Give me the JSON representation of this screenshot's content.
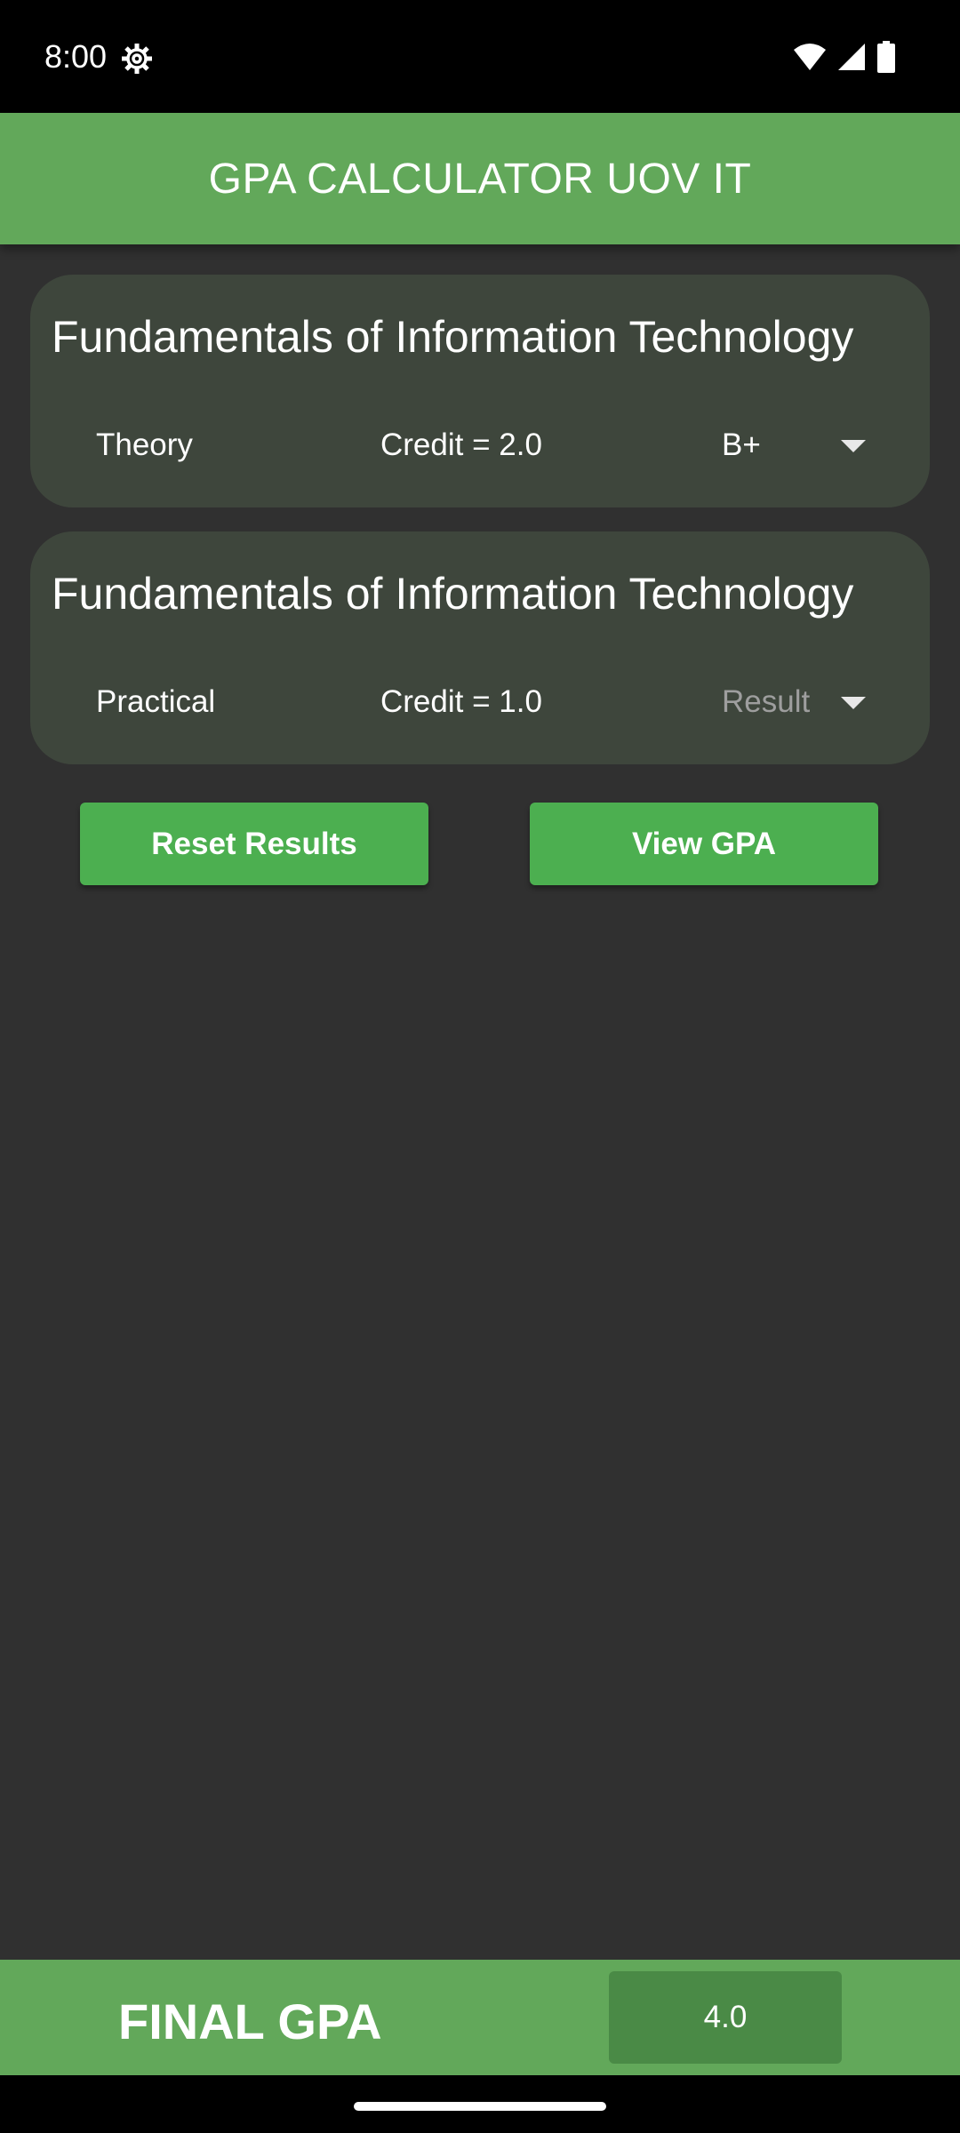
{
  "status_bar": {
    "time": "8:00",
    "icons": [
      "settings-gear-icon",
      "wifi-icon",
      "signal-icon",
      "battery-icon"
    ]
  },
  "app_bar": {
    "title": "GPA CALCULATOR UOV IT",
    "color": "#62a85a"
  },
  "courses": [
    {
      "name": "Fundamentals of Information Technology",
      "type": "Theory",
      "credit": "Credit = 2.0",
      "grade": "B+"
    },
    {
      "name": "Fundamentals of Information Technology",
      "type": "Practical",
      "credit": "Credit = 1.0",
      "grade_placeholder": "Result"
    }
  ],
  "actions": {
    "reset_label": "Reset Results",
    "view_label": "View GPA",
    "button_color": "#4caf50"
  },
  "footer": {
    "label": "FINAL GPA",
    "value": "4.0"
  }
}
